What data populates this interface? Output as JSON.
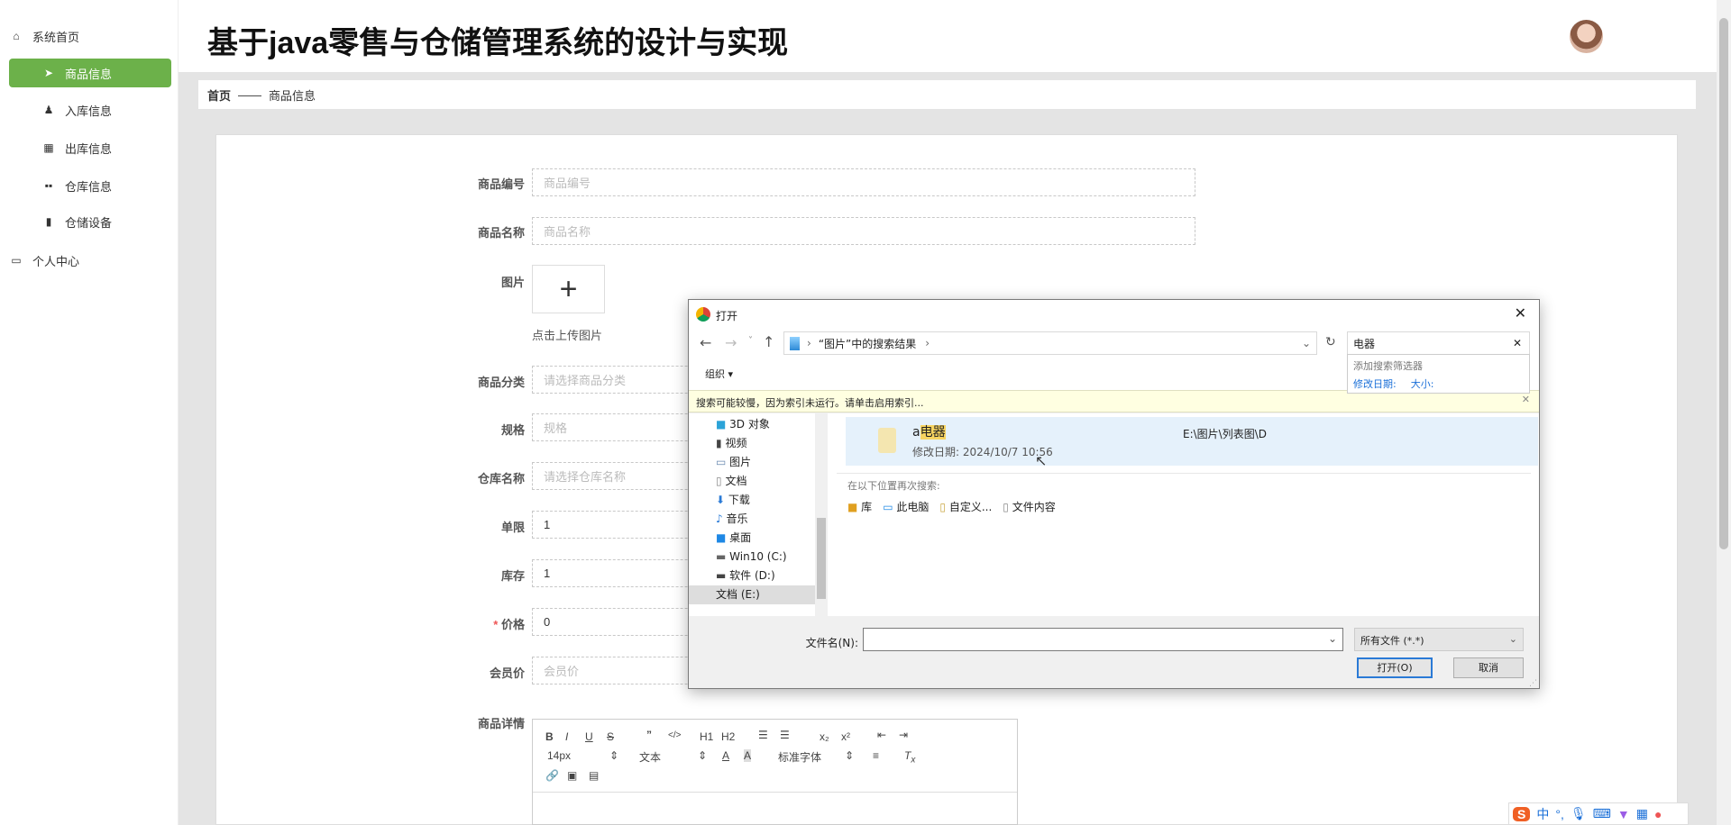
{
  "app": {
    "title": "基于java零售与仓储管理系统的设计与实现"
  },
  "sidebar": {
    "items": [
      {
        "label": "系统首页",
        "icon": "home-icon"
      },
      {
        "label": "商品信息",
        "icon": "paper-plane-icon",
        "active": true
      },
      {
        "label": "入库信息",
        "icon": "user-icon"
      },
      {
        "label": "出库信息",
        "icon": "grid-icon"
      },
      {
        "label": "仓库信息",
        "icon": "blocks-icon"
      },
      {
        "label": "仓储设备",
        "icon": "clipboard-icon"
      },
      {
        "label": "个人中心",
        "icon": "card-icon"
      }
    ]
  },
  "breadcrumb": {
    "home": "首页",
    "sep": "——",
    "current": "商品信息"
  },
  "form": {
    "code": {
      "label": "商品编号",
      "placeholder": "商品编号"
    },
    "name": {
      "label": "商品名称",
      "placeholder": "商品名称"
    },
    "image": {
      "label": "图片",
      "hint": "点击上传图片"
    },
    "category": {
      "label": "商品分类",
      "placeholder": "请选择商品分类"
    },
    "spec": {
      "label": "规格",
      "placeholder": "规格"
    },
    "warehouse": {
      "label": "仓库名称",
      "placeholder": "请选择仓库名称"
    },
    "limit": {
      "label": "单限",
      "value": "1"
    },
    "stock": {
      "label": "库存",
      "value": "1"
    },
    "price": {
      "label": "价格",
      "required": "*",
      "value": "0"
    },
    "member_price": {
      "label": "会员价",
      "placeholder": "会员价"
    },
    "detail": {
      "label": "商品详情"
    }
  },
  "editor": {
    "font_size": "14px",
    "block": "文本",
    "font": "标准字体",
    "h1": "H1",
    "h2": "H2"
  },
  "dialog": {
    "title": "打开",
    "path": "“图片”中的搜索结果",
    "search": "电器",
    "search_suggest": {
      "title": "添加搜索筛选器",
      "date": "修改日期:",
      "size": "大小:"
    },
    "organize": "组织",
    "warning": "搜索可能较慢，因为索引未运行。请单击启用索引...",
    "nav": [
      "3D 对象",
      "视频",
      "图片",
      "文档",
      "下载",
      "音乐",
      "桌面",
      "Win10 (C:)",
      "软件 (D:)",
      "文档 (E:)"
    ],
    "result": {
      "name_prefix": "a",
      "name_match": "电器",
      "date": "修改日期: 2024/10/7 10:56",
      "location": "E:\\图片\\列表图\\D"
    },
    "search_again": "在以下位置再次搜索:",
    "locations": [
      "库",
      "此电脑",
      "自定义...",
      "文件内容"
    ],
    "filename_label": "文件名(N):",
    "filename": "",
    "filter": "所有文件 (*.*)",
    "open": "打开(O)",
    "cancel": "取消"
  },
  "ime": {
    "lang": "中",
    "punct": "°,"
  },
  "colors": {
    "accent": "#6cb14a",
    "selection": "#e5f1fb",
    "warning": "#ffffe1"
  }
}
